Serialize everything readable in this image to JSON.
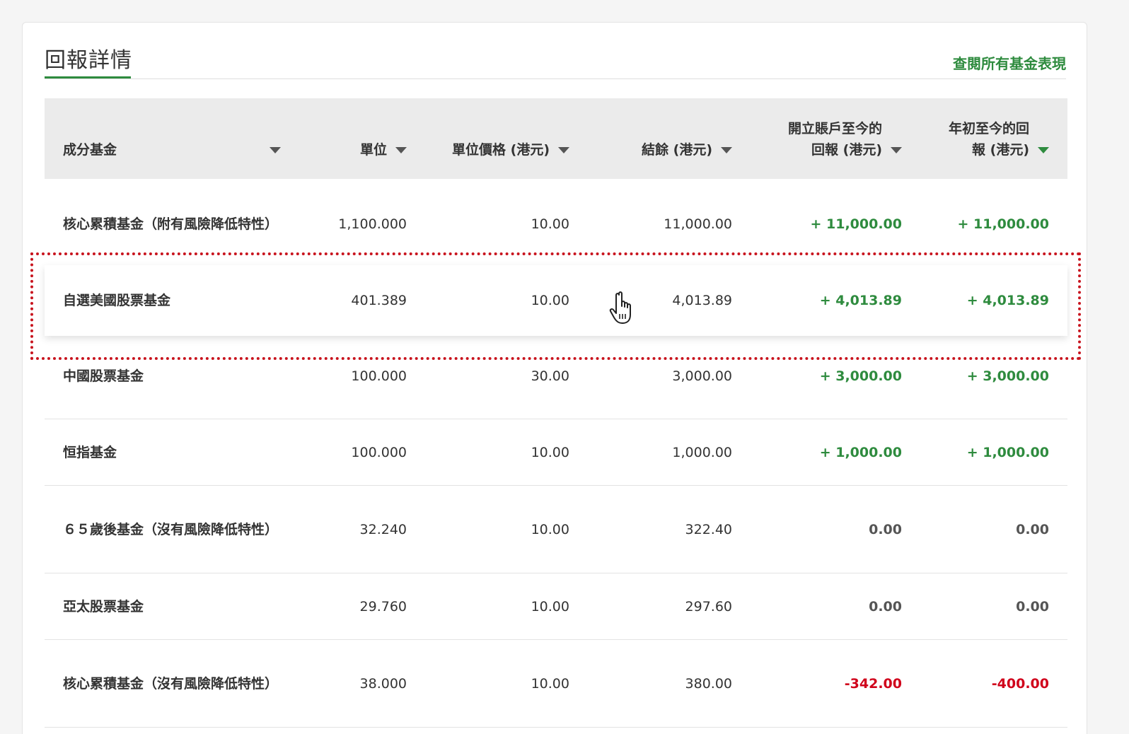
{
  "section": {
    "title": "回報詳情",
    "view_all": "查閱所有基金表現"
  },
  "table": {
    "headers": {
      "fund": "成分基金",
      "units": "單位",
      "unit_price": "單位價格 (港元)",
      "balance": "結餘 (港元)",
      "return_since_open": "開立賬戶至今的\n回報 (港元)",
      "return_ytd": "年初至今的回\n報 (港元)"
    },
    "rows": [
      {
        "fund": "核心累積基金（附有風險降低特性）",
        "units": "1,100.000",
        "unit_price": "10.00",
        "balance": "11,000.00",
        "return_since_open": "+ 11,000.00",
        "return_ytd": "+ 11,000.00",
        "sign": "pos"
      },
      {
        "fund": "自選美國股票基金",
        "units": "401.389",
        "unit_price": "10.00",
        "balance": "4,013.89",
        "return_since_open": "+ 4,013.89",
        "return_ytd": "+ 4,013.89",
        "sign": "pos"
      },
      {
        "fund": "中國股票基金",
        "units": "100.000",
        "unit_price": "30.00",
        "balance": "3,000.00",
        "return_since_open": "+ 3,000.00",
        "return_ytd": "+ 3,000.00",
        "sign": "pos"
      },
      {
        "fund": "恒指基金",
        "units": "100.000",
        "unit_price": "10.00",
        "balance": "1,000.00",
        "return_since_open": "+ 1,000.00",
        "return_ytd": "+ 1,000.00",
        "sign": "pos"
      },
      {
        "fund": "６５歲後基金（沒有風險降低特性）",
        "units": "32.240",
        "unit_price": "10.00",
        "balance": "322.40",
        "return_since_open": "0.00",
        "return_ytd": "0.00",
        "sign": "zero"
      },
      {
        "fund": "亞太股票基金",
        "units": "29.760",
        "unit_price": "10.00",
        "balance": "297.60",
        "return_since_open": "0.00",
        "return_ytd": "0.00",
        "sign": "zero"
      },
      {
        "fund": "核心累積基金（沒有風險降低特性）",
        "units": "38.000",
        "unit_price": "10.00",
        "balance": "380.00",
        "return_since_open": "-342.00",
        "return_ytd": "-400.00",
        "sign": "neg"
      }
    ]
  },
  "colors": {
    "accent": "#2e8b3e",
    "negative": "#d0021b",
    "highlight_border": "#c8141e"
  },
  "icons": {
    "sort": "caret-down-icon",
    "cursor": "hand-pointer-icon"
  }
}
